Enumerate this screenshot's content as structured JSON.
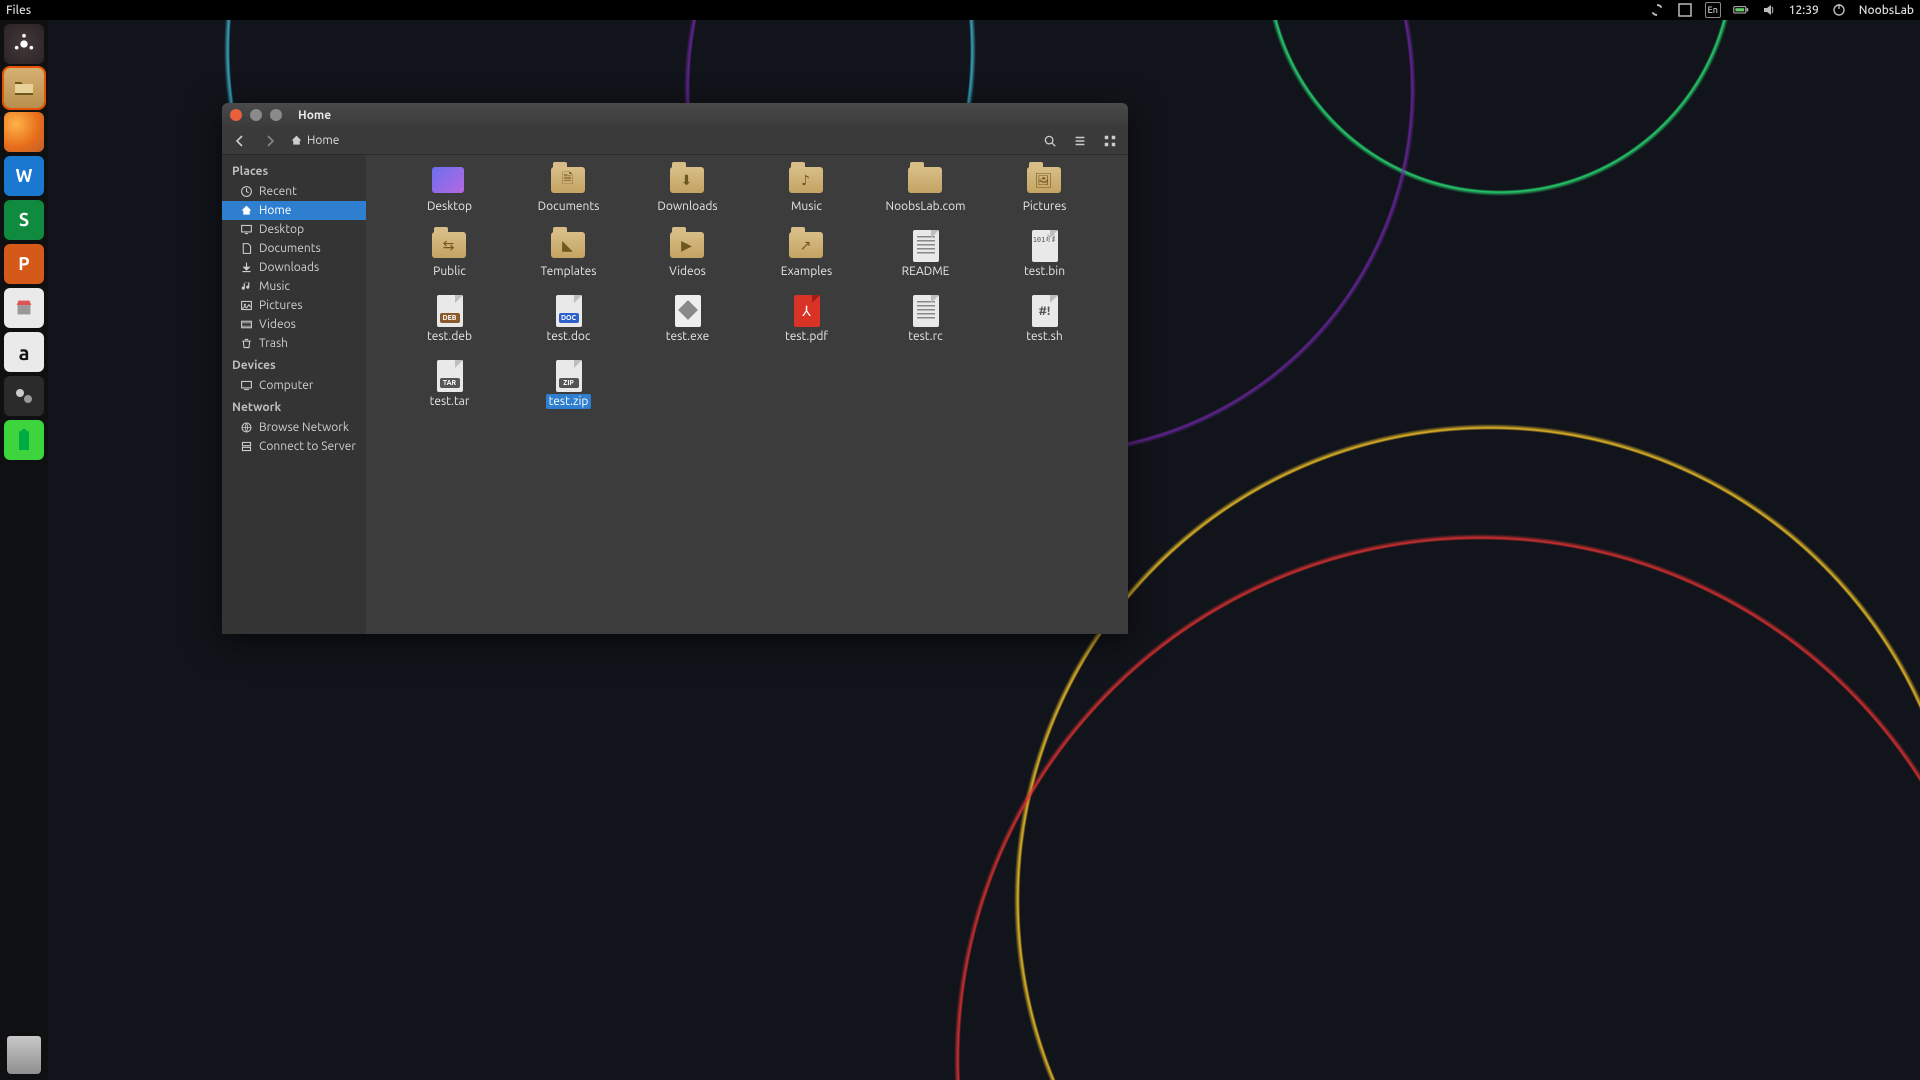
{
  "top_panel": {
    "app_menu": "Files",
    "lang": "En",
    "time": "12:39",
    "session": "NoobsLab"
  },
  "launcher": {
    "tiles": [
      {
        "name": "dash",
        "glyph": "◌"
      },
      {
        "name": "files",
        "glyph": ""
      },
      {
        "name": "firefox",
        "glyph": ""
      },
      {
        "name": "writer",
        "glyph": "W"
      },
      {
        "name": "calc",
        "glyph": "S"
      },
      {
        "name": "impress",
        "glyph": "P"
      },
      {
        "name": "software",
        "glyph": "◎"
      },
      {
        "name": "amazon",
        "glyph": "a"
      },
      {
        "name": "settings",
        "glyph": "⚙"
      },
      {
        "name": "battery",
        "glyph": "▮"
      }
    ]
  },
  "fm": {
    "title": "Home",
    "breadcrumb_label": "Home",
    "sidebar": {
      "places_heading": "Places",
      "places": [
        {
          "label": "Recent",
          "icon": "clock"
        },
        {
          "label": "Home",
          "icon": "home",
          "selected": true
        },
        {
          "label": "Desktop",
          "icon": "desktop"
        },
        {
          "label": "Documents",
          "icon": "doc"
        },
        {
          "label": "Downloads",
          "icon": "down"
        },
        {
          "label": "Music",
          "icon": "music"
        },
        {
          "label": "Pictures",
          "icon": "pic"
        },
        {
          "label": "Videos",
          "icon": "video"
        },
        {
          "label": "Trash",
          "icon": "trash"
        }
      ],
      "devices_heading": "Devices",
      "devices": [
        {
          "label": "Computer",
          "icon": "computer"
        }
      ],
      "network_heading": "Network",
      "network": [
        {
          "label": "Browse Network",
          "icon": "browse"
        },
        {
          "label": "Connect to Server",
          "icon": "server"
        }
      ]
    },
    "items": [
      {
        "label": "Desktop",
        "type": "desktop"
      },
      {
        "label": "Documents",
        "type": "folder",
        "glyph": "🗎"
      },
      {
        "label": "Downloads",
        "type": "folder",
        "glyph": "⬇"
      },
      {
        "label": "Music",
        "type": "folder",
        "glyph": "♪"
      },
      {
        "label": "NoobsLab.com",
        "type": "folder",
        "glyph": ""
      },
      {
        "label": "Pictures",
        "type": "folder",
        "glyph": "🖼"
      },
      {
        "label": "Public",
        "type": "folder",
        "glyph": "⇆"
      },
      {
        "label": "Templates",
        "type": "folder",
        "glyph": "◣"
      },
      {
        "label": "Videos",
        "type": "folder",
        "glyph": "▶"
      },
      {
        "label": "Examples",
        "type": "folder",
        "glyph": "↗"
      },
      {
        "label": "README",
        "type": "file-text"
      },
      {
        "label": "test.bin",
        "type": "file-bin"
      },
      {
        "label": "test.deb",
        "type": "file-band",
        "band": "DEB",
        "band_cls": "deb"
      },
      {
        "label": "test.doc",
        "type": "file-band",
        "band": "DOC",
        "band_cls": "doc"
      },
      {
        "label": "test.exe",
        "type": "file-exe"
      },
      {
        "label": "test.pdf",
        "type": "file-pdf"
      },
      {
        "label": "test.rc",
        "type": "file-text"
      },
      {
        "label": "test.sh",
        "type": "file-sh"
      },
      {
        "label": "test.tar",
        "type": "file-band",
        "band": "TAR",
        "band_cls": "tar"
      },
      {
        "label": "test.zip",
        "type": "file-band",
        "band": "ZIP",
        "band_cls": "zip",
        "selected": true
      }
    ]
  }
}
